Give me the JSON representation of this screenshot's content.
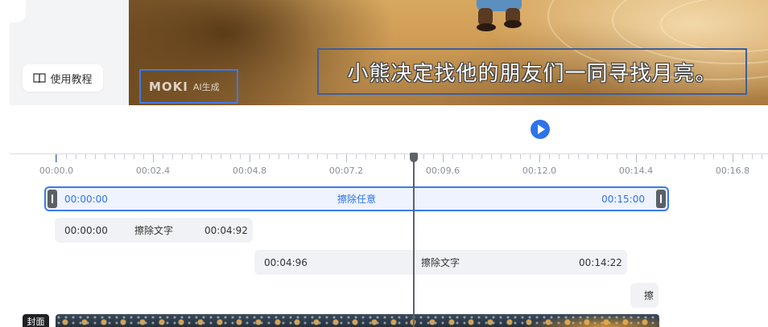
{
  "sidebar": {
    "tutorial_label": "使用教程"
  },
  "preview": {
    "watermark_logo": "MOKI",
    "watermark_text": "AI生成",
    "subtitle": "小熊决定找他的朋友们一同寻找月亮。"
  },
  "ruler": {
    "labels": [
      "00:00.0",
      "00:02.4",
      "00:04.8",
      "00:07.2",
      "00:09.6",
      "00:12.0",
      "00:14.4",
      "00:16.8"
    ]
  },
  "tracks": {
    "main": {
      "start": "00:00:00",
      "label": "擦除任意",
      "end": "00:15:00"
    },
    "clip1": {
      "start": "00:00:00",
      "label": "擦除文字",
      "end": "00:04:92"
    },
    "clip2": {
      "start": "00:04:96",
      "label": "擦除文字",
      "end": "00:14:22"
    },
    "clip3": {
      "label": "擦"
    }
  },
  "video_track": {
    "cover_label": "封面"
  },
  "colors": {
    "accent": "#2f73e8",
    "playhead": "#5d6168"
  }
}
